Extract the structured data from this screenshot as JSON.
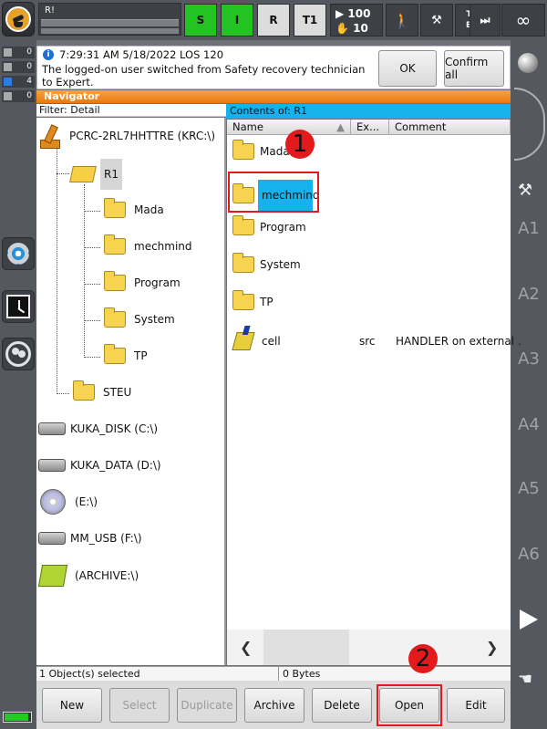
{
  "topbar": {
    "program_name": "R!",
    "status_s": "S",
    "status_i": "I",
    "status_r": "R",
    "mode": "T1",
    "override_line1": "100",
    "override_line2": "10",
    "tool_base": "T? B?",
    "tool_label_t": "T?",
    "tool_label_b": "B?",
    "infinity": "∞",
    "color_green": "#23c321"
  },
  "left_counters": [
    "0",
    "0",
    "4",
    "0"
  ],
  "message": {
    "header": "7:29:31 AM 5/18/2022 LOS 120",
    "text": "The logged-on user switched from Safety recovery technician to Expert.",
    "ok_label": "OK",
    "confirm_all_label": "Confirm all"
  },
  "navigator": {
    "title": "Navigator",
    "filter": "Filter: Detail",
    "contents_of": "Contents of: R1",
    "tree": {
      "root": "PCRC-2RL7HHTTRE (KRC:\\)",
      "r1": "R1",
      "r1_children": [
        "Mada",
        "mechmind",
        "Program",
        "System",
        "TP"
      ],
      "steu": "STEU",
      "drives": [
        "KUKA_DISK (C:\\)",
        "KUKA_DATA (D:\\)",
        "(E:\\)",
        "MM_USB (F:\\)",
        "(ARCHIVE:\\)"
      ]
    },
    "columns": [
      "Name",
      "Ex...",
      "Comment"
    ],
    "rows": [
      {
        "name": "Mada",
        "ext": "",
        "comment": ""
      },
      {
        "name": "mechmind",
        "ext": "",
        "comment": ""
      },
      {
        "name": "Program",
        "ext": "",
        "comment": ""
      },
      {
        "name": "System",
        "ext": "",
        "comment": ""
      },
      {
        "name": "TP",
        "ext": "",
        "comment": ""
      },
      {
        "name": "cell",
        "ext": "src",
        "comment": "HANDLER on external ."
      }
    ],
    "selected_row": "mechmind",
    "status_selected": "1 Object(s) selected",
    "status_bytes": "0 Bytes"
  },
  "buttons": {
    "new": "New",
    "select": "Select",
    "duplicate": "Duplicate",
    "archive": "Archive",
    "delete": "Delete",
    "open": "Open",
    "edit": "Edit"
  },
  "annotations": {
    "badge1": "1",
    "badge2": "2",
    "color_red": "#e3191b"
  },
  "right_axes": [
    "A1",
    "A2",
    "A3",
    "A4",
    "A5",
    "A6"
  ]
}
